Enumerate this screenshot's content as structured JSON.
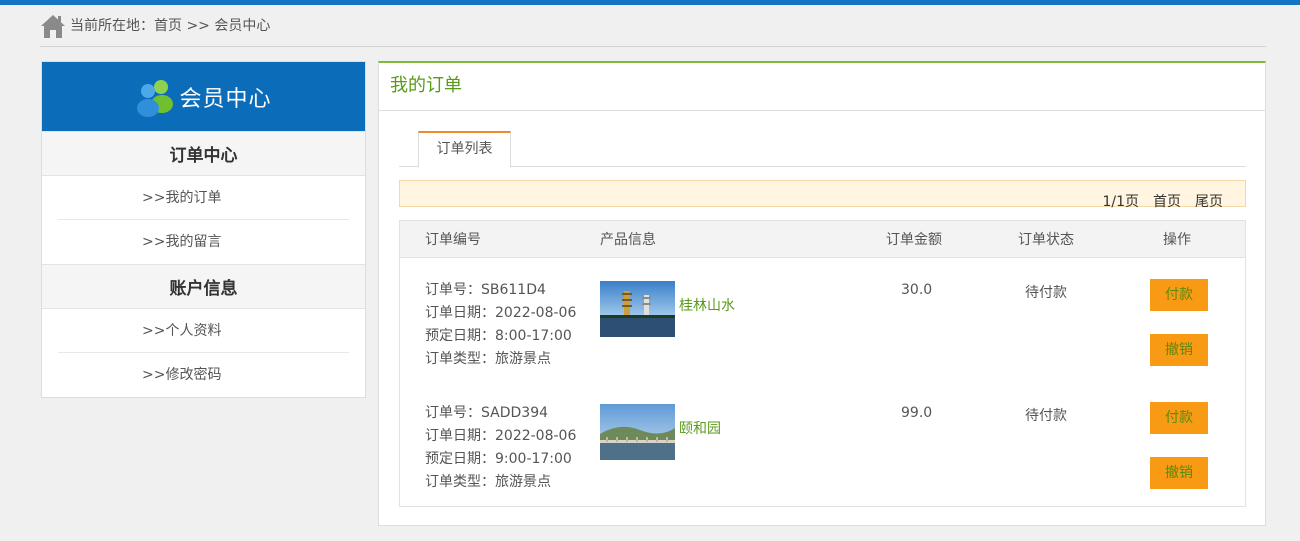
{
  "breadcrumb": {
    "text": "当前所在地：首页 >> 会员中心"
  },
  "sidebar": {
    "title": "会员中心",
    "sections": [
      {
        "title": "订单中心",
        "items": [
          ">>我的订单",
          ">>我的留言"
        ]
      },
      {
        "title": "账户信息",
        "items": [
          ">>个人资料",
          ">>修改密码"
        ]
      }
    ]
  },
  "content": {
    "title": "我的订单",
    "tab": "订单列表",
    "pager": {
      "page": "1/1页",
      "first": "首页",
      "last": "尾页"
    },
    "columns": [
      "订单编号",
      "产品信息",
      "订单金额",
      "订单状态",
      "操作"
    ],
    "orders": [
      {
        "no": "订单号：SB611D4",
        "date": "订单日期：2022-08-06",
        "time": "预定日期：8:00-17:00",
        "type": "订单类型：旅游景点",
        "product": "桂林山水",
        "amount": "30.0",
        "status": "待付款",
        "pay": "付款",
        "cancel": "撤销"
      },
      {
        "no": "订单号：SADD394",
        "date": "订单日期：2022-08-06",
        "time": "预定日期：9:00-17:00",
        "type": "订单类型：旅游景点",
        "product": "颐和园",
        "amount": "99.0",
        "status": "待付款",
        "pay": "付款",
        "cancel": "撤销"
      }
    ]
  },
  "colors": {
    "accent_blue": "#0b6db9",
    "accent_green": "#5a9a1a",
    "button_orange": "#f89a14",
    "tab_orange": "#f08a2a"
  },
  "icons": [
    "home-icon",
    "user-group-icon"
  ]
}
